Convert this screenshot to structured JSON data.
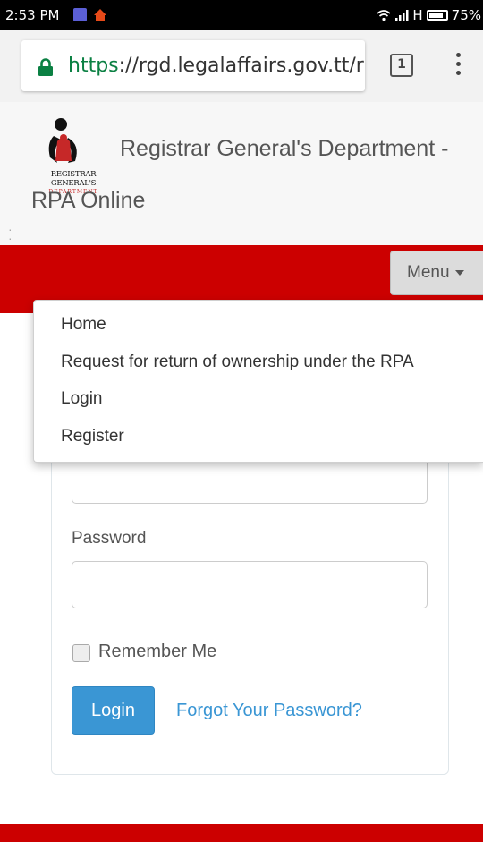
{
  "status_bar": {
    "time": "2:53 PM",
    "signal_text": "H",
    "battery_percent": "75%"
  },
  "browser": {
    "url_scheme": "https",
    "url_rest": "://rgd.legalaffairs.gov.tt/r",
    "tab_count": "1"
  },
  "header": {
    "logo_text": "REGISTRAR GENERAL'S",
    "logo_subtext": "DEPARTMENT",
    "title_line1": "Registrar General's Department -",
    "title_line2": "RPA Online"
  },
  "nav": {
    "menu_label": "Menu"
  },
  "dropdown": {
    "items": [
      {
        "label": "Home"
      },
      {
        "label": "Request for return of ownership under the RPA"
      },
      {
        "label": "Login"
      },
      {
        "label": "Register"
      }
    ]
  },
  "form": {
    "email_value": "",
    "password_label": "Password",
    "password_value": "",
    "remember_label": "Remember Me",
    "remember_checked": false,
    "login_label": "Login",
    "forgot_label": "Forgot Your Password?"
  },
  "colors": {
    "brand_red": "#cc0000",
    "button_blue": "#3a96d4",
    "secure_green": "#0b8043"
  }
}
